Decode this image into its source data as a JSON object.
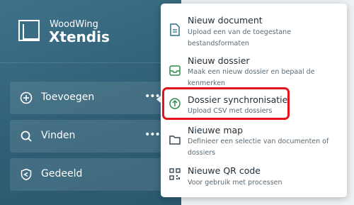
{
  "brand": {
    "line1": "WoodWing",
    "line2": "Xtendis"
  },
  "sidebar": {
    "items": [
      {
        "label": "Toevoegen",
        "icon": "plus-circle-icon",
        "dots": "•••"
      },
      {
        "label": "Vinden",
        "icon": "search-icon",
        "dots": "•••"
      },
      {
        "label": "Gedeeld",
        "icon": "share-shield-icon"
      }
    ]
  },
  "menu": {
    "items": [
      {
        "title": "Nieuw document",
        "description": "Upload een van de toegestane bestandsformaten",
        "icon": "document-icon"
      },
      {
        "title": "Nieuw dossier",
        "description": "Maak een nieuw dossier en bepaal de kenmerken",
        "icon": "inbox-dossier-icon"
      },
      {
        "title": "Dossier synchronisatie",
        "description": "Upload CSV met dossiers",
        "icon": "upload-circle-icon"
      },
      {
        "title": "Nieuwe map",
        "description": "Definieer een selectie van documenten of dossiers",
        "icon": "folder-icon"
      },
      {
        "title": "Nieuwe QR code",
        "description": "Voor gebruik met processen",
        "icon": "qr-code-icon"
      }
    ]
  },
  "colors": {
    "sidebar": "#336880",
    "accent_green": "#2f8a4a",
    "highlight_red": "#e4131b"
  }
}
